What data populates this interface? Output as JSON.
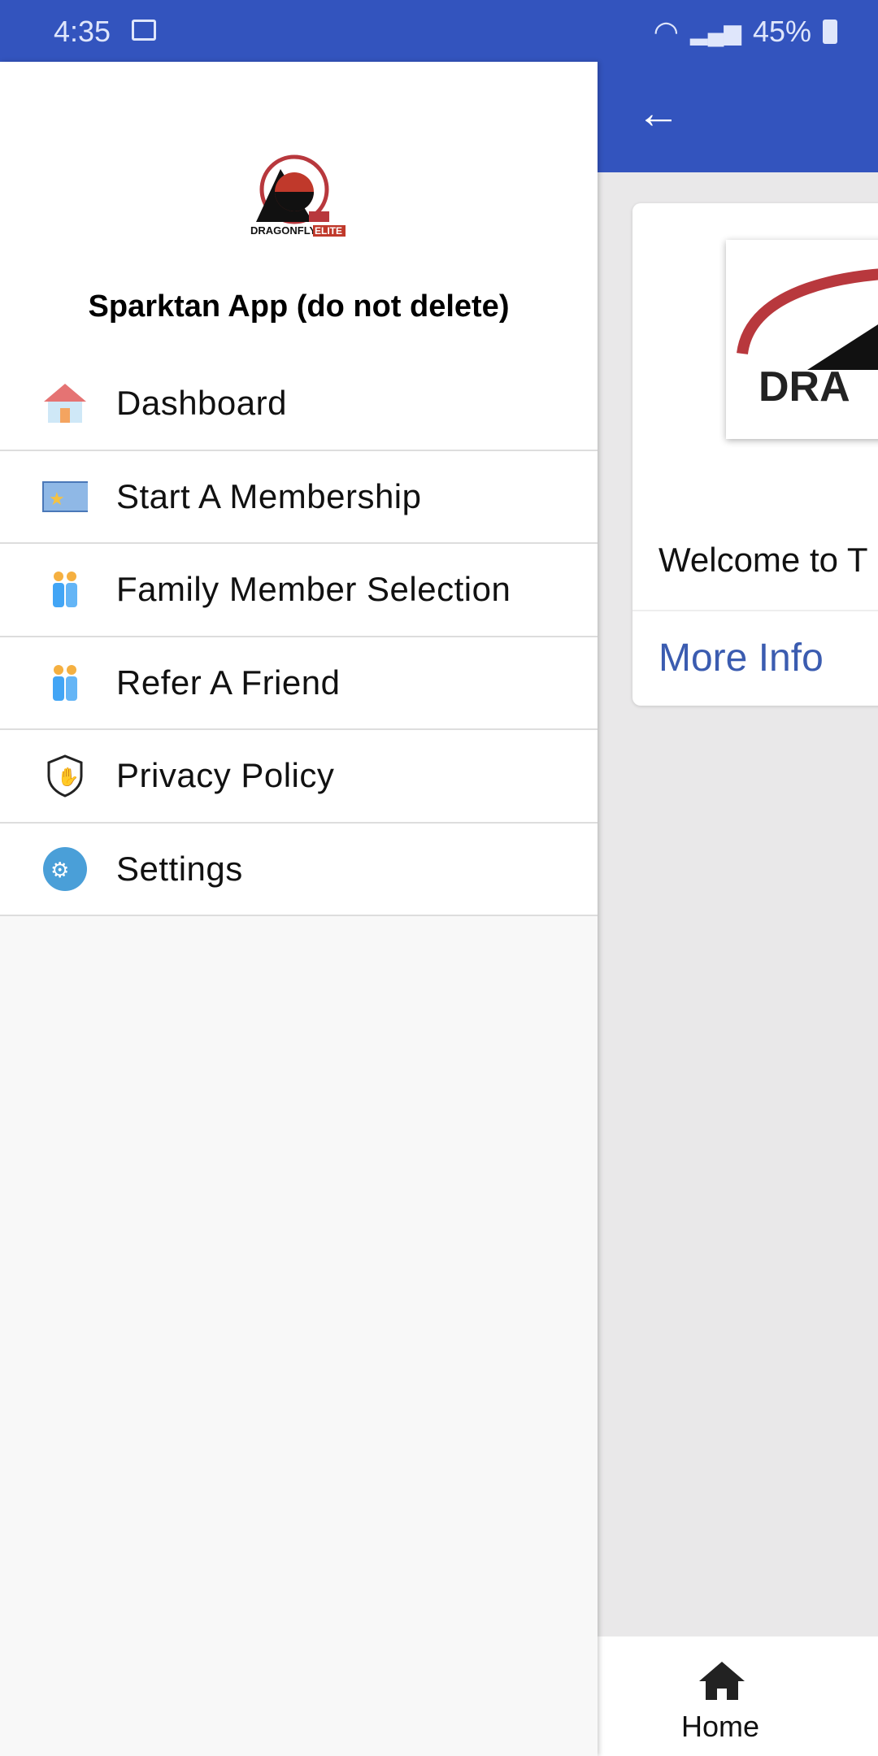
{
  "status_bar": {
    "time": "4:35",
    "battery": "45%"
  },
  "drawer": {
    "logo_text": "DRAGONFLY ELITE .com",
    "title": "Sparktan App (do not delete)",
    "items": [
      {
        "label": "Dashboard",
        "icon": "house-icon"
      },
      {
        "label": "Start A Membership",
        "icon": "membership-card-icon"
      },
      {
        "label": "Family Member Selection",
        "icon": "family-icon"
      },
      {
        "label": "Refer A Friend",
        "icon": "friends-icon"
      },
      {
        "label": "Privacy Policy",
        "icon": "shield-hand-icon"
      },
      {
        "label": "Settings",
        "icon": "gears-icon"
      }
    ]
  },
  "main": {
    "welcome": "Welcome to T",
    "more_info": "More Info",
    "image_text": "DRA"
  },
  "bottom_nav": {
    "home": "Home"
  },
  "colors": {
    "primary": "#3354be",
    "link": "#3b5cb0"
  }
}
